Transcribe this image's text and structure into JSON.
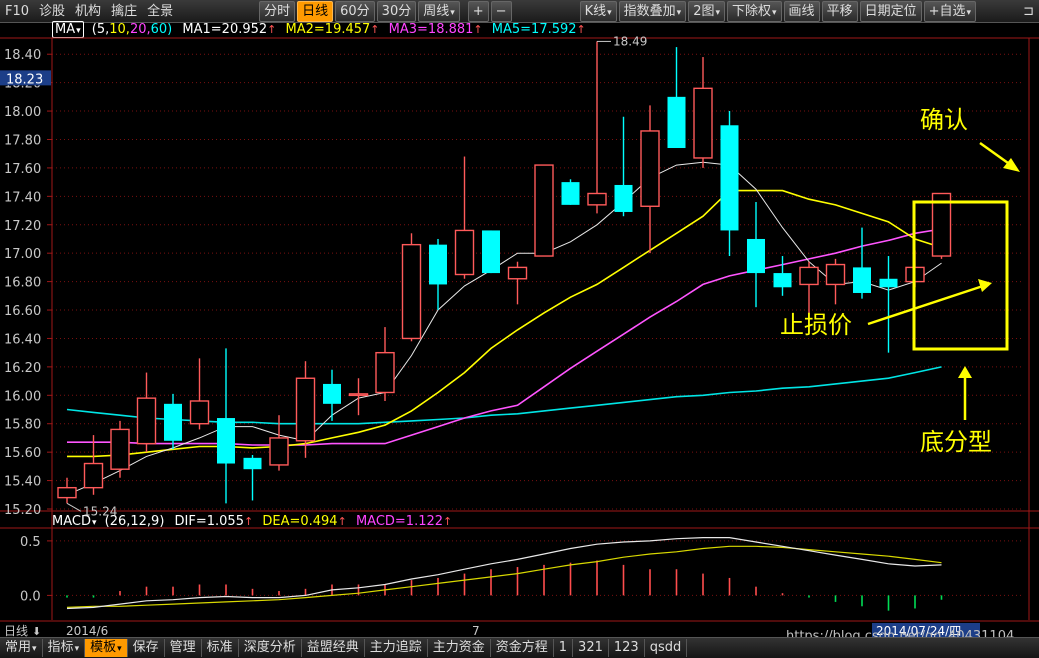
{
  "toolbar": {
    "left": [
      "F10",
      "诊股",
      "机构",
      "擒庄",
      "全景"
    ],
    "periods": [
      "分时",
      "日线",
      "60分",
      "30分",
      "周线"
    ],
    "active_period": "日线",
    "zoom": [
      "+",
      "−"
    ],
    "right": [
      "K线",
      "指数叠加",
      "2图",
      "下除权",
      "画线",
      "平移",
      "日期定位",
      "自选"
    ]
  },
  "legend": {
    "indicator": "MA",
    "params_open": "(5,",
    "p2": "10,",
    "p3": "20,",
    "p4": "60)",
    "ma1": "MA1=20.952",
    "ma2": "MA2=19.457",
    "ma3": "MA3=18.881",
    "ma5": "MA5=17.592",
    "arrow": "↑"
  },
  "macd_legend": {
    "indicator": "MACD",
    "params": "(26,12,9)",
    "dif": "DIF=1.055",
    "dea": "DEA=0.494",
    "macd": "MACD=1.122",
    "arrow": "↑"
  },
  "price_labels": {
    "current": "18.23",
    "high": "18.49",
    "low": "15.24"
  },
  "annotations": {
    "confirm": "确认",
    "stoploss": "止损价",
    "bottom": "底分型"
  },
  "xaxis": {
    "period": "日线",
    "start": "2014/6",
    "mid": "7",
    "cursor_date": "2014/07/24/四"
  },
  "bottom_tabs": [
    "常用",
    "指标",
    "模板",
    "保存",
    "管理",
    "标准",
    "深度分析",
    "益盟经典",
    "主力追踪",
    "主力资金",
    "资金方程",
    "1",
    "321",
    "123",
    "qsdd"
  ],
  "active_bottom_tab": "模板",
  "watermark": "https://blog.csdn.net/qq_40431104",
  "colors": {
    "up": "#ff5a5a",
    "down": "#00ffff",
    "ma1": "#e8e8e8",
    "ma2": "#ffff00",
    "ma3": "#ff55ff",
    "ma5": "#00e5e5",
    "annotation": "#ffff00"
  },
  "chart_data": [
    {
      "type": "candlestick",
      "ylim": [
        15.2,
        18.5
      ],
      "yticks": [
        15.2,
        15.4,
        15.6,
        15.8,
        16.0,
        16.2,
        16.4,
        16.6,
        16.8,
        17.0,
        17.2,
        17.4,
        17.6,
        17.8,
        18.0,
        18.2,
        18.4
      ],
      "candles": [
        {
          "o": 15.28,
          "h": 15.42,
          "l": 15.24,
          "c": 15.35
        },
        {
          "o": 15.35,
          "h": 15.72,
          "l": 15.3,
          "c": 15.52
        },
        {
          "o": 15.48,
          "h": 15.82,
          "l": 15.42,
          "c": 15.76
        },
        {
          "o": 15.66,
          "h": 16.16,
          "l": 15.6,
          "c": 15.98
        },
        {
          "o": 15.94,
          "h": 16.01,
          "l": 15.62,
          "c": 15.68
        },
        {
          "o": 15.8,
          "h": 16.26,
          "l": 15.76,
          "c": 15.96
        },
        {
          "o": 15.84,
          "h": 16.33,
          "l": 15.24,
          "c": 15.52
        },
        {
          "o": 15.56,
          "h": 15.58,
          "l": 15.26,
          "c": 15.48
        },
        {
          "o": 15.51,
          "h": 15.86,
          "l": 15.47,
          "c": 15.7
        },
        {
          "o": 15.68,
          "h": 16.24,
          "l": 15.56,
          "c": 16.12
        },
        {
          "o": 16.08,
          "h": 16.18,
          "l": 15.82,
          "c": 15.94
        },
        {
          "o": 16.01,
          "h": 16.12,
          "l": 15.86,
          "c": 16.01
        },
        {
          "o": 16.02,
          "h": 16.48,
          "l": 15.96,
          "c": 16.3
        },
        {
          "o": 16.4,
          "h": 17.14,
          "l": 16.38,
          "c": 17.06
        },
        {
          "o": 17.06,
          "h": 17.1,
          "l": 16.6,
          "c": 16.78
        },
        {
          "o": 16.85,
          "h": 17.68,
          "l": 16.82,
          "c": 17.16
        },
        {
          "o": 17.16,
          "h": 17.16,
          "l": 16.86,
          "c": 16.86
        },
        {
          "o": 16.82,
          "h": 16.94,
          "l": 16.64,
          "c": 16.9
        },
        {
          "o": 16.98,
          "h": 17.6,
          "l": 16.98,
          "c": 17.62
        },
        {
          "o": 17.5,
          "h": 17.52,
          "l": 17.34,
          "c": 17.34
        },
        {
          "o": 17.34,
          "h": 18.49,
          "l": 17.28,
          "c": 17.42
        },
        {
          "o": 17.48,
          "h": 17.96,
          "l": 17.26,
          "c": 17.29
        },
        {
          "o": 17.33,
          "h": 18.04,
          "l": 17.0,
          "c": 17.86
        },
        {
          "o": 18.1,
          "h": 18.45,
          "l": 17.74,
          "c": 17.74
        },
        {
          "o": 17.67,
          "h": 18.38,
          "l": 17.6,
          "c": 18.16
        },
        {
          "o": 17.9,
          "h": 18.0,
          "l": 16.98,
          "c": 17.16
        },
        {
          "o": 17.1,
          "h": 17.36,
          "l": 16.62,
          "c": 16.86
        },
        {
          "o": 16.86,
          "h": 16.98,
          "l": 16.7,
          "c": 16.76
        },
        {
          "o": 16.78,
          "h": 16.94,
          "l": 16.52,
          "c": 16.9
        },
        {
          "o": 16.78,
          "h": 16.96,
          "l": 16.64,
          "c": 16.92
        },
        {
          "o": 16.9,
          "h": 17.18,
          "l": 16.68,
          "c": 16.72
        },
        {
          "o": 16.82,
          "h": 16.98,
          "l": 16.3,
          "c": 16.76
        },
        {
          "o": 16.8,
          "h": 17.02,
          "l": 16.76,
          "c": 16.9
        },
        {
          "o": 16.98,
          "h": 17.42,
          "l": 16.96,
          "c": 17.42
        }
      ],
      "ma1": [
        15.3,
        15.38,
        15.47,
        15.57,
        15.63,
        15.7,
        15.78,
        15.78,
        15.72,
        15.68,
        15.86,
        15.98,
        16.02,
        16.28,
        16.6,
        16.77,
        16.88,
        17.0,
        17.0,
        17.08,
        17.2,
        17.36,
        17.53,
        17.62,
        17.64,
        17.62,
        17.45,
        17.18,
        16.94,
        16.78,
        16.8,
        16.74,
        16.8,
        16.93
      ],
      "ma2": [
        15.57,
        15.57,
        15.58,
        15.6,
        15.62,
        15.64,
        15.64,
        15.63,
        15.64,
        15.66,
        15.7,
        15.74,
        15.79,
        15.89,
        16.02,
        16.16,
        16.33,
        16.46,
        16.58,
        16.69,
        16.78,
        16.9,
        17.02,
        17.14,
        17.26,
        17.44,
        17.44,
        17.44,
        17.38,
        17.34,
        17.28,
        17.22,
        17.1,
        17.04
      ],
      "ma3": [
        15.67,
        15.67,
        15.67,
        15.66,
        15.66,
        15.66,
        15.66,
        15.65,
        15.65,
        15.65,
        15.66,
        15.66,
        15.66,
        15.72,
        15.78,
        15.84,
        15.89,
        15.93,
        16.06,
        16.19,
        16.31,
        16.43,
        16.55,
        16.66,
        16.78,
        16.84,
        16.88,
        16.92,
        16.96,
        17.0,
        17.05,
        17.09,
        17.14,
        17.17
      ],
      "ma5": [
        15.9,
        15.88,
        15.86,
        15.84,
        15.83,
        15.82,
        15.81,
        15.81,
        15.8,
        15.8,
        15.8,
        15.8,
        15.81,
        15.82,
        15.83,
        15.84,
        15.86,
        15.87,
        15.89,
        15.91,
        15.93,
        15.95,
        15.97,
        15.99,
        16.0,
        16.02,
        16.03,
        16.05,
        16.06,
        16.08,
        16.1,
        16.12,
        16.16,
        16.2
      ]
    },
    {
      "type": "line",
      "title": "MACD",
      "ylim": [
        -0.18,
        0.6
      ],
      "yticks": [
        0.0,
        0.5
      ],
      "dif": [
        -0.12,
        -0.11,
        -0.08,
        -0.05,
        -0.04,
        -0.02,
        -0.01,
        -0.02,
        -0.02,
        0.0,
        0.05,
        0.07,
        0.1,
        0.15,
        0.19,
        0.24,
        0.29,
        0.33,
        0.38,
        0.43,
        0.47,
        0.49,
        0.5,
        0.52,
        0.53,
        0.53,
        0.49,
        0.45,
        0.41,
        0.37,
        0.33,
        0.29,
        0.27,
        0.28
      ],
      "dea": [
        -0.11,
        -0.1,
        -0.1,
        -0.09,
        -0.08,
        -0.07,
        -0.06,
        -0.05,
        -0.04,
        -0.02,
        0.0,
        0.02,
        0.05,
        0.08,
        0.11,
        0.14,
        0.17,
        0.2,
        0.24,
        0.28,
        0.31,
        0.35,
        0.38,
        0.4,
        0.43,
        0.45,
        0.45,
        0.44,
        0.42,
        0.4,
        0.38,
        0.36,
        0.33,
        0.3
      ],
      "macd": [
        -0.02,
        -0.02,
        0.04,
        0.08,
        0.08,
        0.1,
        0.1,
        0.06,
        0.04,
        0.06,
        0.1,
        0.1,
        0.1,
        0.14,
        0.16,
        0.2,
        0.24,
        0.26,
        0.28,
        0.3,
        0.32,
        0.28,
        0.24,
        0.24,
        0.2,
        0.16,
        0.08,
        0.02,
        -0.02,
        -0.06,
        -0.1,
        -0.14,
        -0.12,
        -0.04
      ]
    }
  ]
}
